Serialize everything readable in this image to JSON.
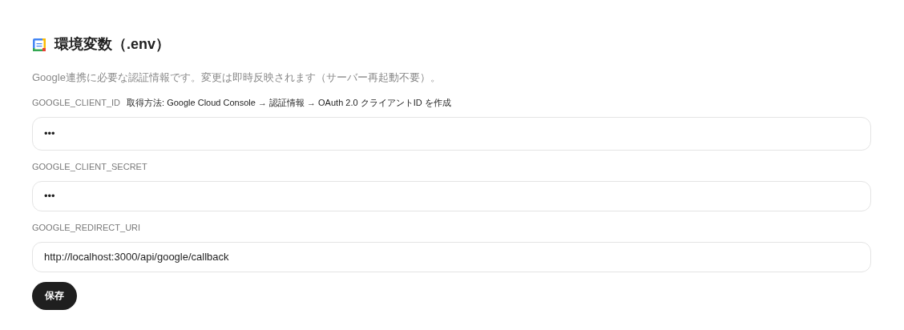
{
  "title": "環境変数（.env）",
  "description": "Google連携に必要な認証情報です。変更は即時反映されます（サーバー再起動不要）。",
  "fields": [
    {
      "label": "GOOGLE_CLIENT_ID",
      "hint": "取得方法: Google Cloud Console → 認証情報 → OAuth 2.0 クライアントID を作成",
      "value": "•••"
    },
    {
      "label": "GOOGLE_CLIENT_SECRET",
      "value": "•••"
    },
    {
      "label": "GOOGLE_REDIRECT_URI",
      "value": "http://localhost:3000/api/google/callback"
    }
  ],
  "save_button": "保存"
}
